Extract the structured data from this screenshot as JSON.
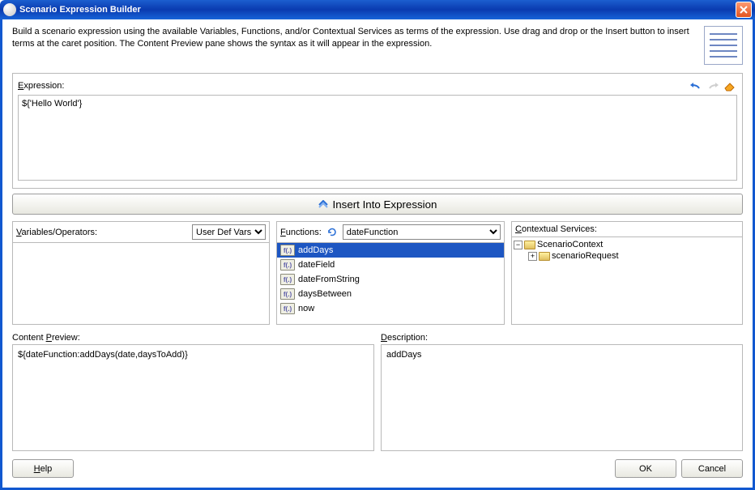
{
  "window": {
    "title": "Scenario Expression Builder"
  },
  "instructions": "Build a scenario expression using the available Variables, Functions, and/or Contextual Services as terms of the expression. Use drag and drop or the Insert button to insert terms at the caret position. The Content Preview pane shows the syntax as it will appear in the expression.",
  "expression": {
    "label_pre": "E",
    "label_post": "xpression:",
    "value": "${'Hello World'}"
  },
  "insert_label": "Insert Into Expression",
  "variables": {
    "label_pre": "V",
    "label_post": "ariables/Operators:",
    "dropdown_options": [
      "User Def Vars"
    ],
    "dropdown_selected": "User Def Vars"
  },
  "functions": {
    "label_pre": "F",
    "label_post": "unctions:",
    "category_selected": "dateFunction",
    "category_options": [
      "dateFunction"
    ],
    "items": [
      {
        "name": "addDays",
        "selected": true
      },
      {
        "name": "dateField",
        "selected": false
      },
      {
        "name": "dateFromString",
        "selected": false
      },
      {
        "name": "daysBetween",
        "selected": false
      },
      {
        "name": "now",
        "selected": false
      }
    ]
  },
  "contextual": {
    "label_pre": "C",
    "label_post": "ontextual Services:",
    "tree": [
      {
        "name": "ScenarioContext",
        "expanded": true,
        "children": [
          {
            "name": "scenarioRequest",
            "expanded": false
          }
        ]
      }
    ]
  },
  "content_preview": {
    "label_pre": "Content ",
    "label_u": "P",
    "label_post": "review:",
    "value": "${dateFunction:addDays(date,daysToAdd)}"
  },
  "description": {
    "label_pre": "D",
    "label_post": "escription:",
    "value": "addDays"
  },
  "buttons": {
    "help": "Help",
    "ok": "OK",
    "cancel": "Cancel",
    "help_u": "H",
    "help_post": "elp"
  }
}
